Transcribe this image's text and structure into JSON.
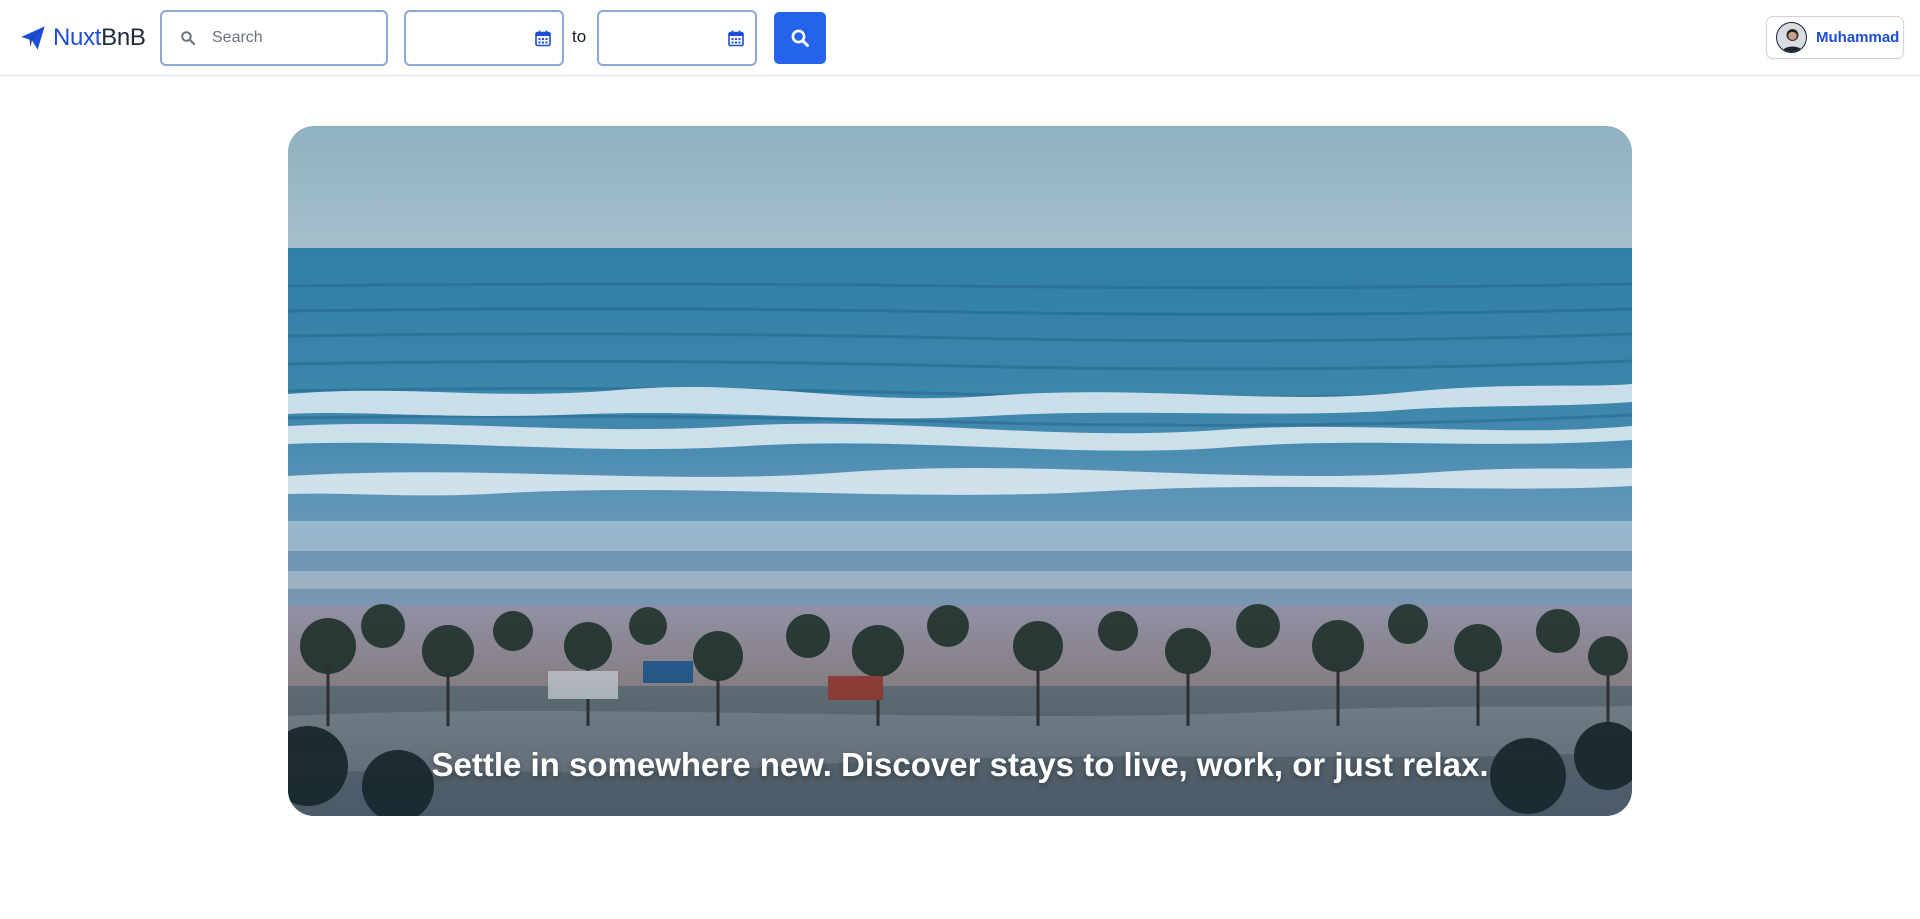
{
  "header": {
    "logo": {
      "primary": "Nuxt",
      "secondary": "BnB",
      "icon": "paper-plane-icon",
      "color": "#1d4ed8"
    },
    "search": {
      "placeholder": "Search",
      "value": "",
      "icon": "search-icon"
    },
    "date_range": {
      "from_value": "",
      "separator": "to",
      "to_value": "",
      "icon": "calendar-icon"
    },
    "search_button": {
      "icon": "search-icon",
      "color": "#2563eb"
    },
    "user": {
      "name": "Muhammad",
      "avatar": "avatar-image"
    }
  },
  "hero": {
    "caption": "Settle in somewhere new. Discover stays to live, work, or just relax.",
    "image": "beach-aerial-photo"
  }
}
